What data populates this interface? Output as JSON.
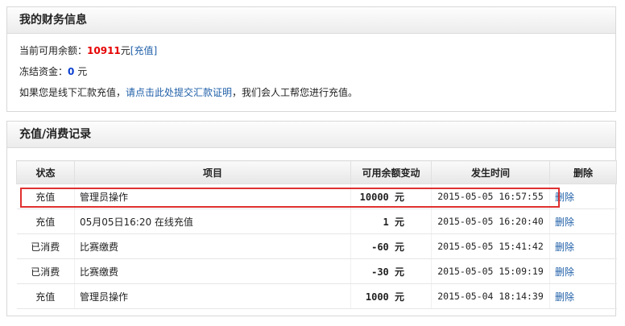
{
  "finance": {
    "title": "我的财务信息",
    "balance_label": "当前可用余额：",
    "balance_value": "10911",
    "balance_unit": "元",
    "recharge_link": "[充值]",
    "frozen_label": "冻结资金：",
    "frozen_value": "0",
    "frozen_unit": "元",
    "offline_prefix": "如果您是线下汇款充值，",
    "offline_link": "请点击此处提交汇款证明",
    "offline_suffix": "，我们会人工帮您进行充值。"
  },
  "records": {
    "title": "充值/消费记录",
    "headers": [
      "状态",
      "项目",
      "可用余额变动",
      "发生时间",
      "删除"
    ],
    "rows": [
      {
        "status": "充值",
        "item": "管理员操作",
        "amount": "10000 元",
        "time": "2015-05-05 16:57:55",
        "action": "删除"
      },
      {
        "status": "充值",
        "item": "05月05日16:20 在线充值",
        "amount": "1 元",
        "time": "2015-05-05 16:20:40",
        "action": "删除"
      },
      {
        "status": "已消费",
        "item": "比赛缴费",
        "amount": "-60 元",
        "time": "2015-05-05 15:41:42",
        "action": "删除"
      },
      {
        "status": "已消费",
        "item": "比赛缴费",
        "amount": "-30 元",
        "time": "2015-05-05 15:09:19",
        "action": "删除"
      },
      {
        "status": "充值",
        "item": "管理员操作",
        "amount": "1000 元",
        "time": "2015-05-04 18:14:39",
        "action": "删除"
      }
    ]
  },
  "colors": {
    "balance": "#e60000",
    "frozen": "#0a3fd0",
    "link": "#1f5fa8",
    "highlight": "#e03030"
  }
}
